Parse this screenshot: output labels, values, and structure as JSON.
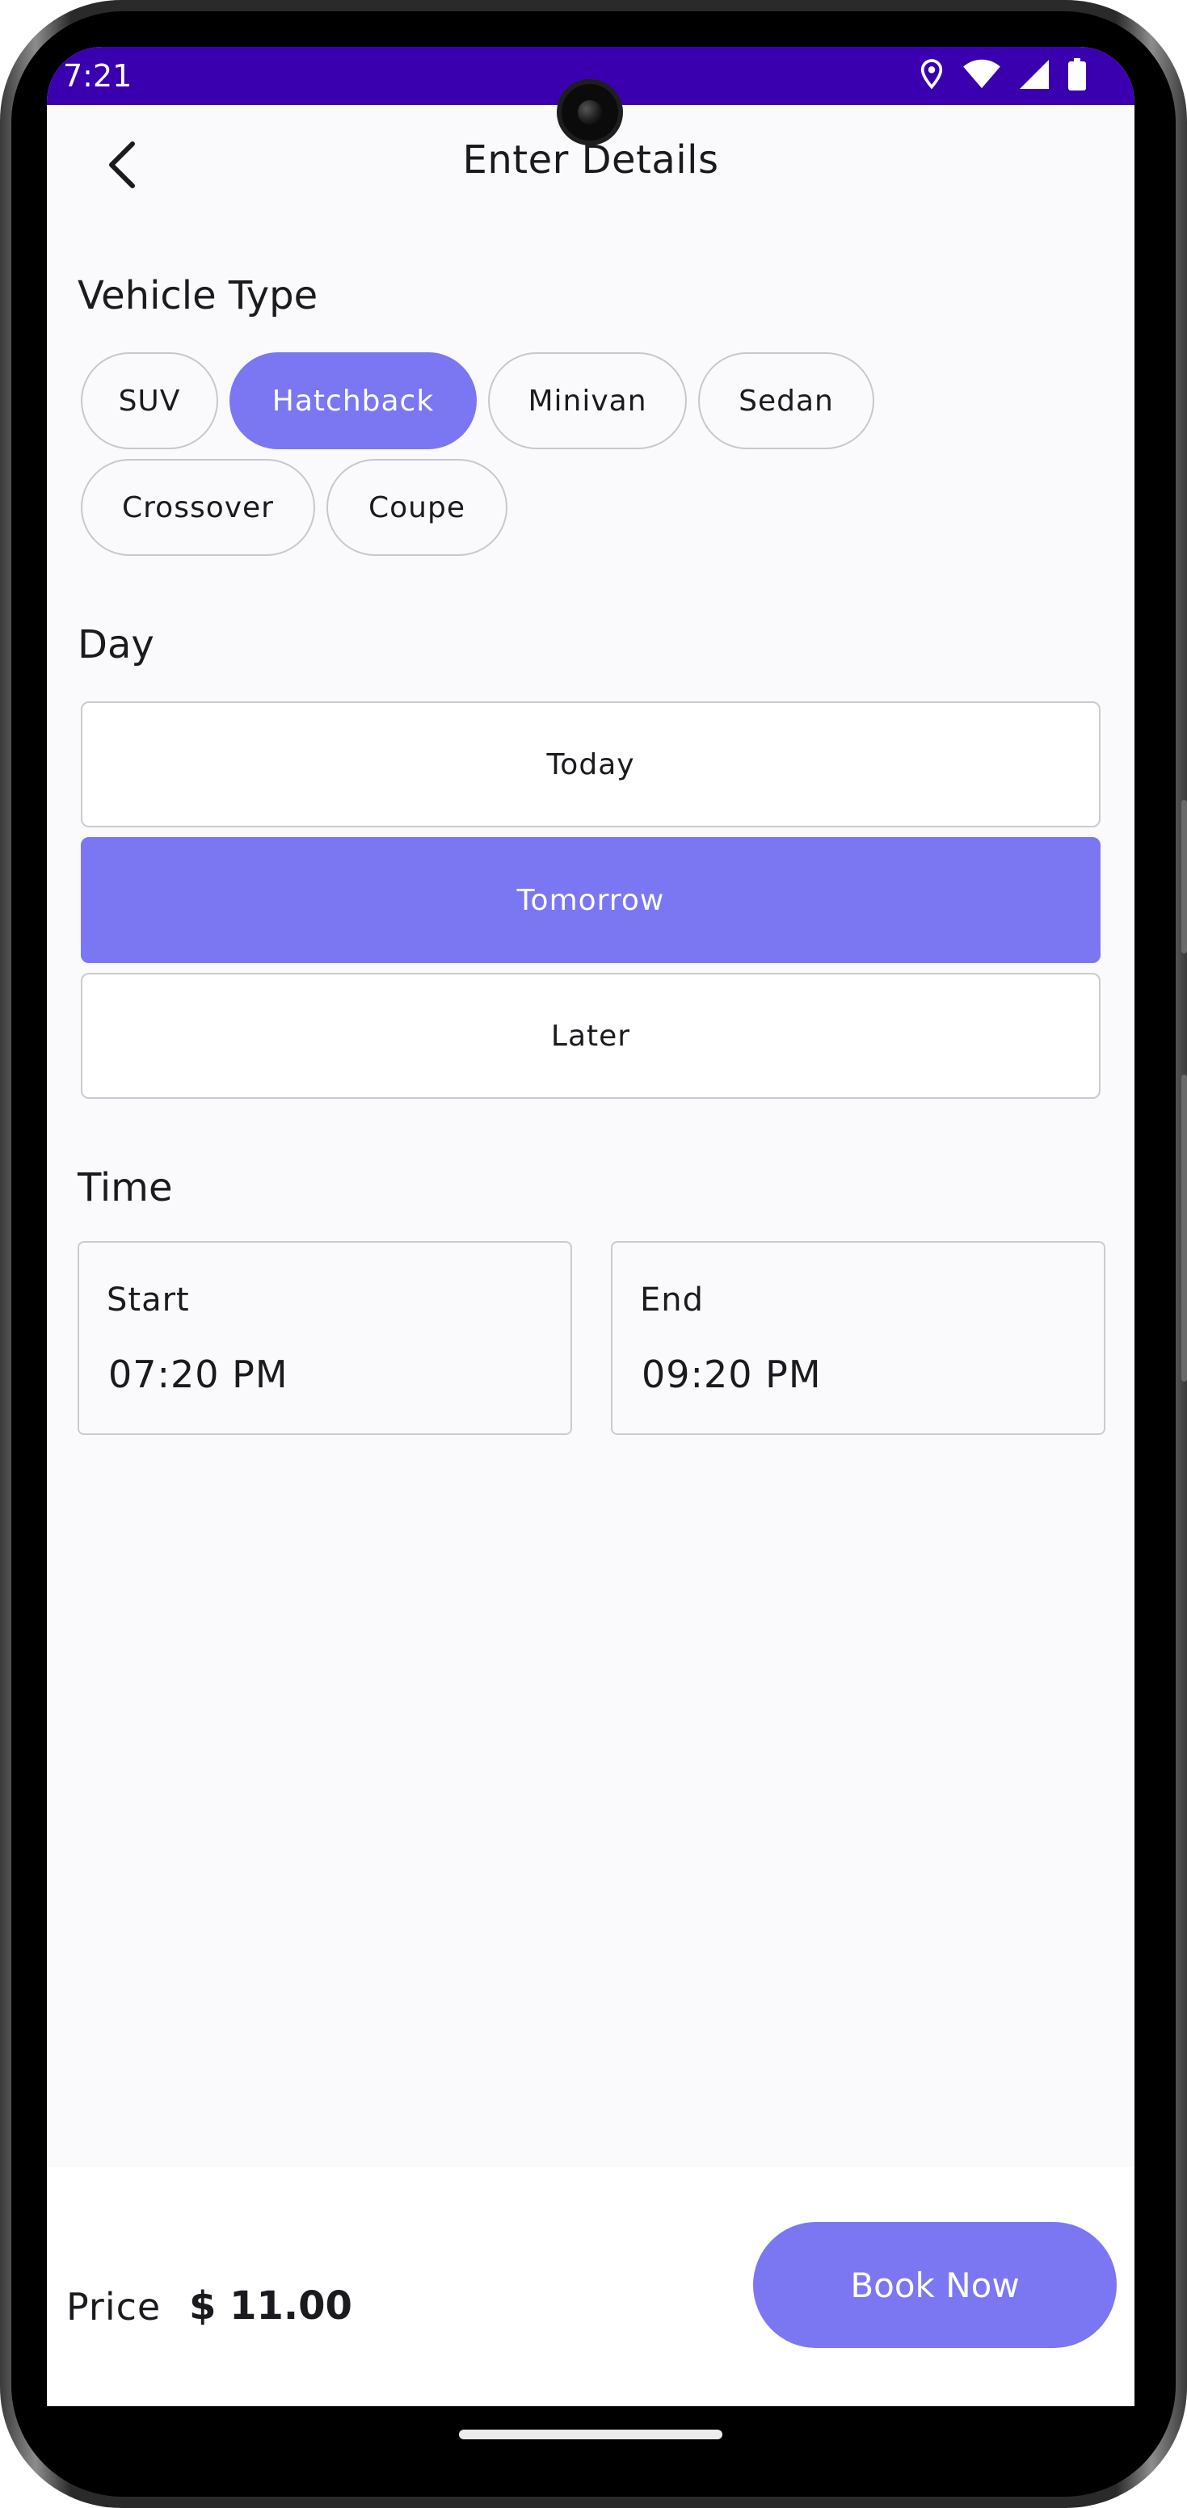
{
  "status_bar": {
    "time": "7:21",
    "icons": [
      "location-icon",
      "wifi-icon",
      "signal-icon",
      "battery-icon"
    ],
    "background": "#3a00b0"
  },
  "header": {
    "title": "Enter Details",
    "back_icon": "chevron-left-icon"
  },
  "vehicle_type": {
    "label": "Vehicle Type",
    "options": [
      "SUV",
      "Hatchback",
      "Minivan",
      "Sedan",
      "Crossover",
      "Coupe"
    ],
    "selected": "Hatchback"
  },
  "day": {
    "label": "Day",
    "options": [
      "Today",
      "Tomorrow",
      "Later"
    ],
    "selected": "Tomorrow"
  },
  "time": {
    "label": "Time",
    "start_label": "Start",
    "start_value": "07:20 PM",
    "end_label": "End",
    "end_value": "09:20 PM"
  },
  "footer": {
    "price_label": "Price",
    "price_value": "$ 11.00",
    "book_label": "Book Now"
  },
  "colors": {
    "accent": "#7b77f2",
    "status_bar": "#3a00b0"
  }
}
